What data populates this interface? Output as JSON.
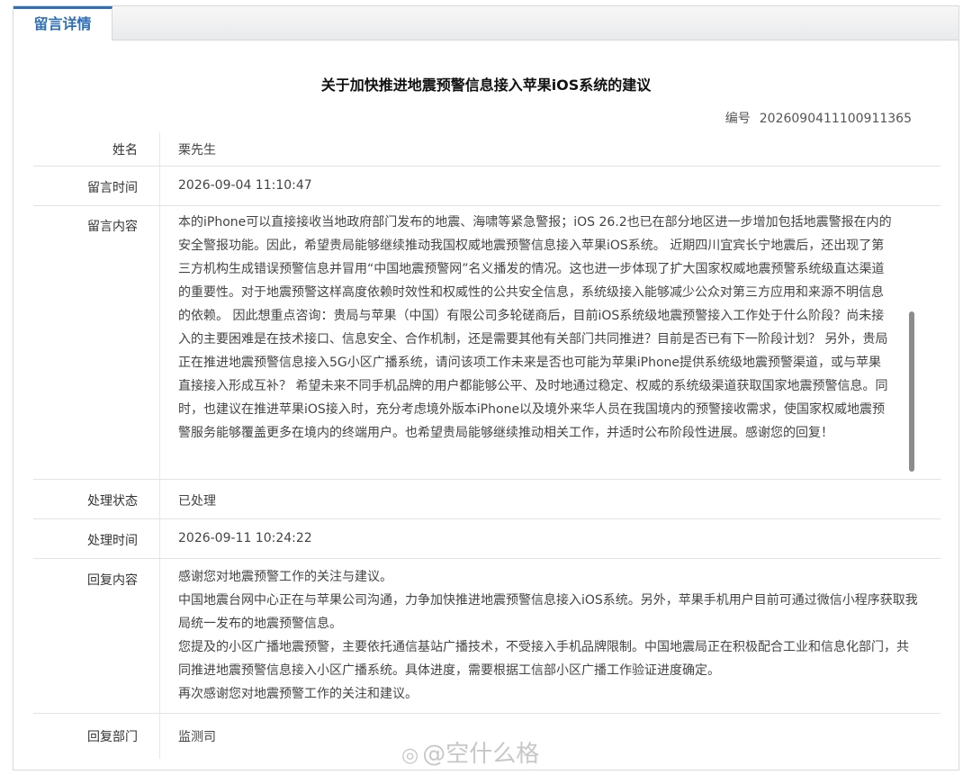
{
  "tab": {
    "label": "留言详情"
  },
  "title": "关于加快推进地震预警信息接入苹果iOS系统的建议",
  "serial": {
    "label": "编号",
    "value": "2026090411100911365"
  },
  "fields": {
    "name": {
      "label": "姓名",
      "value": "栗先生"
    },
    "submit_time": {
      "label": "留言时间",
      "value": "2026-09-04 11:10:47"
    },
    "content": {
      "label": "留言内容",
      "lines": [
        "本的iPhone可以直接接收当地政府部门发布的地震、海啸等紧急警报；iOS 26.2也已在部分地区进一步增加包括地震警报在内的",
        "安全警报功能。因此，希望贵局能够继续推动我国权威地震预警信息接入苹果iOS系统。 近期四川宜宾长宁地震后，还出现了第",
        "三方机构生成错误预警信息并冒用“中国地震预警网”名义播发的情况。这也进一步体现了扩大国家权威地震预警系统级直达渠道",
        "的重要性。对于地震预警这样高度依赖时效性和权威性的公共安全信息，系统级接入能够减少公众对第三方应用和来源不明信息",
        "的依赖。 因此想重点咨询：贵局与苹果（中国）有限公司多轮磋商后，目前iOS系统级地震预警接入工作处于什么阶段？尚未接",
        "入的主要困难是在技术接口、信息安全、合作机制，还是需要其他有关部门共同推进？目前是否已有下一阶段计划？ 另外，贵局",
        "正在推进地震预警信息接入5G小区广播系统，请问该项工作未来是否也可能为苹果iPhone提供系统级地震预警渠道，或与苹果",
        "直接接入形成互补？ 希望未来不同手机品牌的用户都能够公平、及时地通过稳定、权威的系统级渠道获取国家地震预警信息。同",
        "时，也建议在推进苹果iOS接入时，充分考虑境外版本iPhone以及境外来华人员在我国境内的预警接收需求，使国家权威地震预",
        "警服务能够覆盖更多在境内的终端用户。也希望贵局能够继续推动相关工作，并适时公布阶段性进展。感谢您的回复！"
      ]
    },
    "status": {
      "label": "处理状态",
      "value": "已处理"
    },
    "process_time": {
      "label": "处理时间",
      "value": "2026-09-11 10:24:22"
    },
    "reply": {
      "label": "回复内容",
      "lines": [
        "感谢您对地震预警工作的关注与建议。",
        "中国地震台网中心正在与苹果公司沟通，力争加快推进地震预警信息接入iOS系统。另外，苹果手机用户目前可通过微信小程序获取我",
        "局统一发布的地震预警信息。",
        "您提及的小区广播地震预警，主要依托通信基站广播技术，不受接入手机品牌限制。中国地震局正在积极配合工业和信息化部门，共",
        "同推进地震预警信息接入小区广播系统。具体进度，需要根据工信部小区广播工作验证进度确定。",
        "再次感谢您对地震预警工作的关注和建议。"
      ]
    },
    "department": {
      "label": "回复部门",
      "value": "监测司"
    }
  },
  "watermark": {
    "text": "@空什么格",
    "icon": "weibo-icon"
  },
  "colors": {
    "accent": "#2e6fb8",
    "border": "#d9d9d9"
  }
}
